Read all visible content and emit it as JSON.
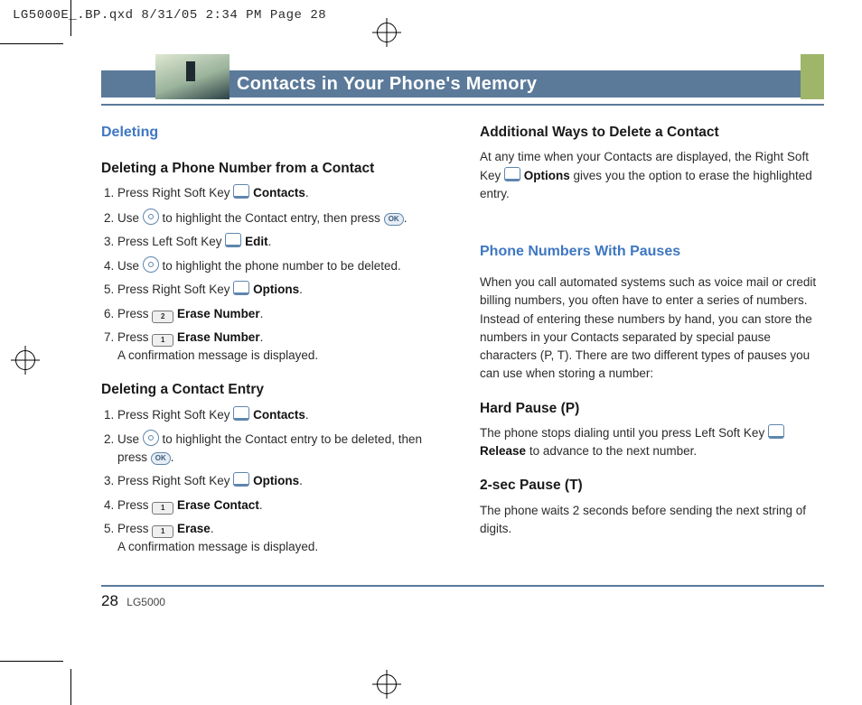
{
  "crop_header": "LG5000E_.BP.qxd  8/31/05  2:34 PM  Page 28",
  "banner_title": "Contacts in Your Phone's Memory",
  "left": {
    "section": "Deleting",
    "sub1": "Deleting a Phone Number from a Contact",
    "s1": {
      "i1a": "Press Right Soft Key ",
      "i1b": "Contacts",
      "i1c": ".",
      "i2a": "Use ",
      "i2b": " to highlight the Contact entry, then press ",
      "i2c": ".",
      "i3a": "Press Left Soft Key ",
      "i3b": "Edit",
      "i3c": ".",
      "i4a": "Use ",
      "i4b": " to highlight the phone number to be deleted.",
      "i5a": "Press Right Soft Key ",
      "i5b": "Options",
      "i5c": ".",
      "i6a": "Press ",
      "i6b": "Erase Number",
      "i6c": ".",
      "i7a": "Press ",
      "i7b": "Erase Number",
      "i7c": ".",
      "i7d": "A confirmation message is displayed."
    },
    "sub2": "Deleting a Contact Entry",
    "s2": {
      "i1a": "Press Right Soft Key ",
      "i1b": "Contacts",
      "i1c": ".",
      "i2a": "Use ",
      "i2b": " to highlight the Contact entry to be deleted, then press ",
      "i2c": ".",
      "i3a": "Press Right Soft Key ",
      "i3b": "Options",
      "i3c": ".",
      "i4a": "Press ",
      "i4b": "Erase Contact",
      "i4c": ".",
      "i5a": "Press ",
      "i5b": "Erase",
      "i5c": ".",
      "i5d": "A confirmation message is displayed."
    }
  },
  "right": {
    "sub1": "Additional Ways to Delete a Contact",
    "p1a": "At any time when your Contacts are displayed, the Right Soft Key ",
    "p1b": "Options",
    "p1c": " gives you the option to erase the highlighted entry.",
    "section2": "Phone Numbers With Pauses",
    "p2": "When you call automated systems such as voice mail or credit billing numbers, you often have to enter a series of numbers. Instead of entering these numbers by hand, you can store the numbers in your Contacts separated by special pause characters (P, T). There are two different types of pauses you can use when storing a number:",
    "hp_title": "Hard Pause (P)",
    "hp_a": "The phone stops dialing until you press Left Soft Key ",
    "hp_b": "Release",
    "hp_c": " to advance to the next number.",
    "sp_title": "2-sec Pause (T)",
    "sp": "The phone waits 2 seconds before sending the next string of digits."
  },
  "keys": {
    "num2": "2",
    "num1": "1",
    "ok": "OK"
  },
  "footer": {
    "page": "28",
    "model": "LG5000"
  }
}
